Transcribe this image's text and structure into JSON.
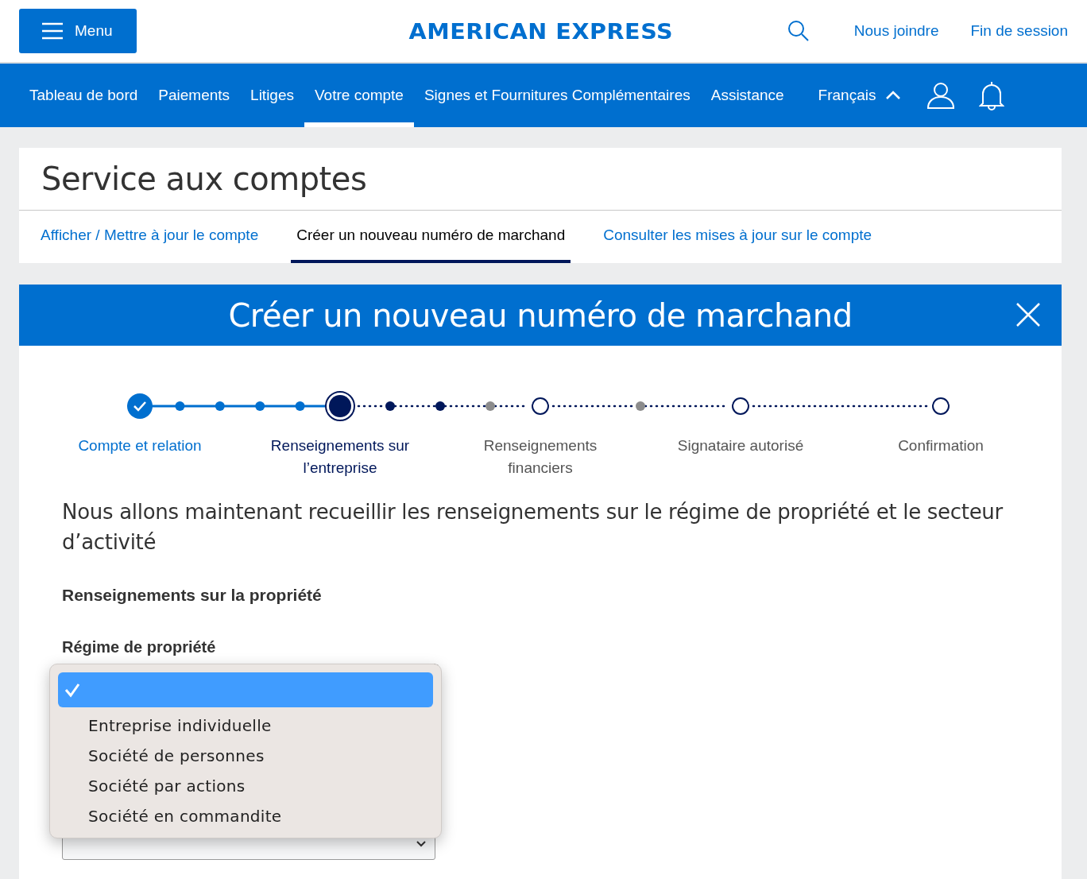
{
  "header": {
    "menu_button": "Menu",
    "logo": "AMERICAN EXPRESS",
    "links": [
      "Nous joindre",
      "Fin de session"
    ]
  },
  "nav": {
    "items": [
      {
        "label": "Tableau de bord",
        "selected": false
      },
      {
        "label": "Paiements",
        "selected": false
      },
      {
        "label": "Litiges",
        "selected": false
      },
      {
        "label": "Votre compte",
        "selected": true
      },
      {
        "label": "Signes et Fournitures Complémentaires",
        "selected": false
      },
      {
        "label": "Assistance",
        "selected": false
      }
    ],
    "language": "Français",
    "language_expanded": true
  },
  "account_card": {
    "title": "Service aux comptes",
    "tabs": [
      {
        "label": "Afficher / Mettre à jour le compte",
        "selected": false
      },
      {
        "label": "Créer un nouveau numéro de marchand",
        "selected": true
      },
      {
        "label": "Consulter les mises à jour sur le compte",
        "selected": false
      }
    ]
  },
  "panel": {
    "title": "Créer un nouveau numéro de marchand",
    "steps": [
      {
        "label": "Compte et relation",
        "kind": "done",
        "substeps": [
          {
            "kind": "done"
          },
          {
            "kind": "done"
          },
          {
            "kind": "done"
          },
          {
            "kind": "done"
          }
        ]
      },
      {
        "label": "Renseignements sur l’entreprise",
        "kind": "current",
        "substeps": [
          {
            "kind": "current"
          },
          {
            "kind": "current"
          },
          {
            "kind": "inactive"
          }
        ]
      },
      {
        "label": "Renseignements financiers",
        "kind": "todo",
        "substeps": [
          {
            "kind": "inactive"
          }
        ]
      },
      {
        "label": "Signataire autorisé",
        "kind": "todo"
      },
      {
        "label": "Confirmation",
        "kind": "todo"
      }
    ],
    "intro": "Nous allons maintenant recueillir les renseignements sur le régime de propriété et le secteur d’activité",
    "section_heading": "Renseignements sur la propriété",
    "field_label": "Régime de propriété",
    "dropdown": [
      {
        "selected": true
      },
      {
        "label": "Entreprise individuelle",
        "selected": false
      },
      {
        "label": "Société de personnes",
        "selected": false
      },
      {
        "label": "Société par actions",
        "selected": false
      },
      {
        "label": "Société en commandite",
        "selected": false
      }
    ]
  }
}
